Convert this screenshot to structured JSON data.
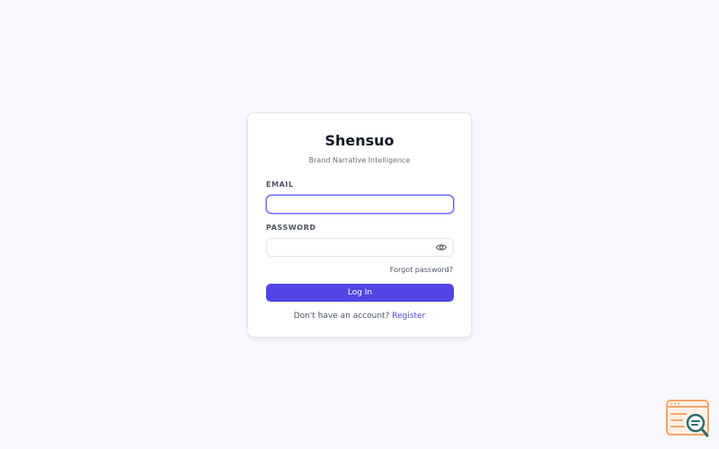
{
  "app": {
    "title": "Shensuo",
    "subtitle": "Brand Narrative Intelligence"
  },
  "form": {
    "email_label": "EMAIL",
    "email_value": "",
    "password_label": "PASSWORD",
    "password_value": "",
    "toggle_visibility_icon": "eye-icon",
    "forgot_password": "Forgot password?",
    "login_button": "Log In",
    "register_prompt": "Don't have an account?",
    "register_link": "Register"
  },
  "colors": {
    "accent": "#4f46e5",
    "focus_ring": "#6366f1",
    "background": "#f7f9fc",
    "card": "#ffffff",
    "badge_orange": "#f3a56b",
    "badge_teal": "#2f6b6b"
  },
  "badge": {
    "icon": "search-analytics-badge-icon"
  }
}
